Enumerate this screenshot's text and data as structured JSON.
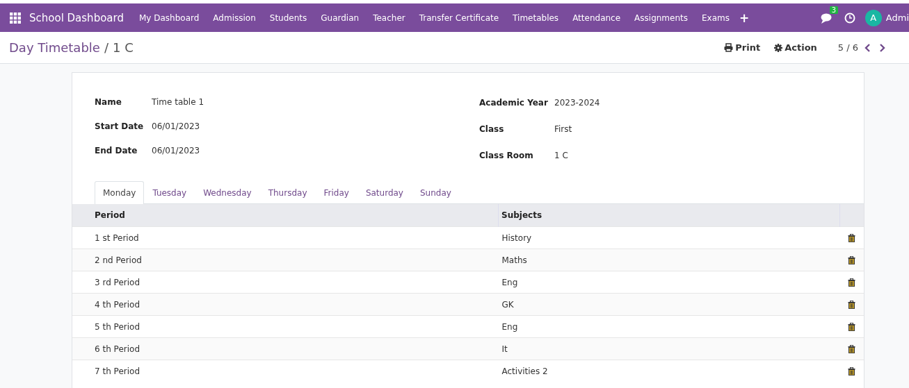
{
  "navbar": {
    "app_title": "School Dashboard",
    "menu": [
      "My Dashboard",
      "Admission",
      "Students",
      "Guardian",
      "Teacher",
      "Transfer Certificate",
      "Timetables",
      "Attendance",
      "Assignments",
      "Exams"
    ],
    "add_button": "+",
    "messages_badge": "3",
    "user_initial": "A",
    "user_name": "Admi"
  },
  "breadcrumb": {
    "parent": "Day Timetable",
    "separator": "/",
    "current": "1 C"
  },
  "toolbar": {
    "print": "Print",
    "action": "Action",
    "pager": "5 / 6"
  },
  "form": {
    "left": [
      {
        "label": "Name",
        "value": "Time table 1"
      },
      {
        "label": "Start Date",
        "value": "06/01/2023"
      },
      {
        "label": "End Date",
        "value": "06/01/2023"
      }
    ],
    "right": [
      {
        "label": "Academic Year",
        "value": "2023-2024"
      },
      {
        "label": "Class",
        "value": "First"
      },
      {
        "label": "Class Room",
        "value": "1 C"
      }
    ]
  },
  "tabs": [
    {
      "label": "Monday",
      "selected": true
    },
    {
      "label": "Tuesday",
      "selected": false
    },
    {
      "label": "Wednesday",
      "selected": false
    },
    {
      "label": "Thursday",
      "selected": false
    },
    {
      "label": "Friday",
      "selected": false
    },
    {
      "label": "Saturday",
      "selected": false
    },
    {
      "label": "Sunday",
      "selected": false
    }
  ],
  "table": {
    "columns": [
      "Period",
      "Subjects"
    ],
    "rows": [
      {
        "period": "1 st Period",
        "subject": "History"
      },
      {
        "period": "2 nd Period",
        "subject": "Maths"
      },
      {
        "period": "3 rd Period",
        "subject": "Eng"
      },
      {
        "period": "4 th Period",
        "subject": "GK"
      },
      {
        "period": "5 th Period",
        "subject": "Eng"
      },
      {
        "period": "6 th Period",
        "subject": "It"
      },
      {
        "period": "7 th Period",
        "subject": "Activities 2"
      }
    ]
  }
}
